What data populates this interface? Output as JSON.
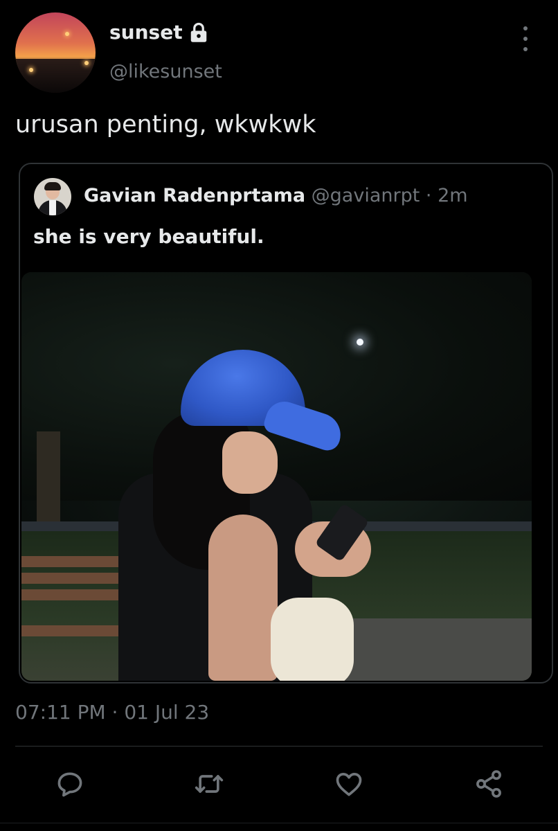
{
  "tweet": {
    "author": {
      "display_name": "sunset",
      "handle": "@likesunset",
      "protected_icon": "lock-icon"
    },
    "text": "urusan penting, wkwkwk",
    "timestamp": "07:11 PM · 01 Jul 23"
  },
  "quoted_tweet": {
    "display_name": "Gavian Radenprtama",
    "handle": "@gavianrpt",
    "time_ago": "· 2m",
    "text": "she is very beautiful."
  },
  "actions": [
    {
      "name": "reply",
      "icon": "reply-icon"
    },
    {
      "name": "retweet",
      "icon": "retweet-icon"
    },
    {
      "name": "like",
      "icon": "heart-icon"
    },
    {
      "name": "share",
      "icon": "share-icon"
    }
  ],
  "colors": {
    "background": "#000000",
    "primary_text": "#e7e9ea",
    "secondary_text": "#71767b",
    "border": "#2f3336"
  }
}
